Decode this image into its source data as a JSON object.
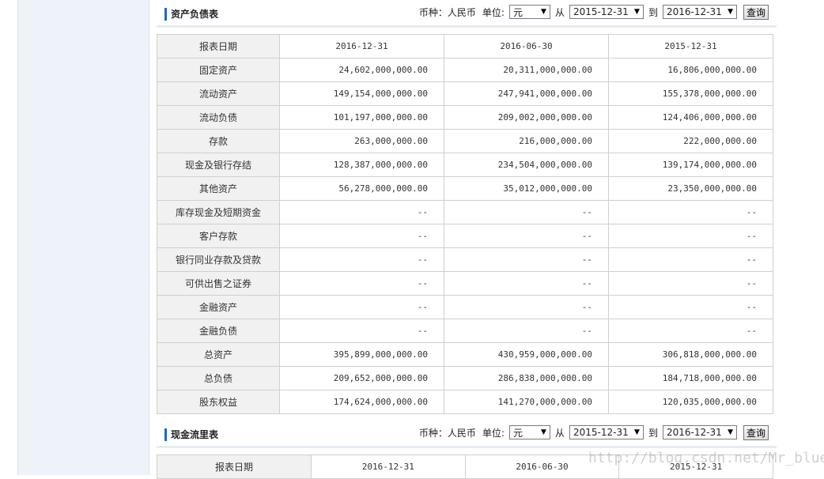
{
  "balance_sheet": {
    "title": "资产负债表",
    "currency_label": "币种：人民币",
    "unit_label": "单位:",
    "unit_value": "元",
    "from_label": "从",
    "from_date": "2015-12-31",
    "to_label": "到",
    "to_date": "2016-12-31",
    "query_label": "查询",
    "header_label": "报表日期",
    "header_dates": [
      "2016-12-31",
      "2016-06-30",
      "2015-12-31"
    ],
    "rows": [
      {
        "label": "固定资产",
        "values": [
          "24,602,000,000.00",
          "20,311,000,000.00",
          "16,806,000,000.00"
        ]
      },
      {
        "label": "流动资产",
        "values": [
          "149,154,000,000.00",
          "247,941,000,000.00",
          "155,378,000,000.00"
        ]
      },
      {
        "label": "流动负债",
        "values": [
          "101,197,000,000.00",
          "209,002,000,000.00",
          "124,406,000,000.00"
        ]
      },
      {
        "label": "存款",
        "values": [
          "263,000,000.00",
          "216,000,000.00",
          "222,000,000.00"
        ]
      },
      {
        "label": "现金及银行存结",
        "values": [
          "128,387,000,000.00",
          "234,504,000,000.00",
          "139,174,000,000.00"
        ]
      },
      {
        "label": "其他资产",
        "values": [
          "56,278,000,000.00",
          "35,012,000,000.00",
          "23,350,000,000.00"
        ]
      },
      {
        "label": "库存现金及短期资金",
        "values": [
          "--",
          "--",
          "--"
        ]
      },
      {
        "label": "客户存款",
        "values": [
          "--",
          "--",
          "--"
        ]
      },
      {
        "label": "银行同业存款及贷款",
        "values": [
          "--",
          "--",
          "--"
        ]
      },
      {
        "label": "可供出售之证券",
        "values": [
          "--",
          "--",
          "--"
        ]
      },
      {
        "label": "金融资产",
        "values": [
          "--",
          "--",
          "--"
        ]
      },
      {
        "label": "金融负债",
        "values": [
          "--",
          "--",
          "--"
        ]
      },
      {
        "label": "总资产",
        "values": [
          "395,899,000,000.00",
          "430,959,000,000.00",
          "306,818,000,000.00"
        ]
      },
      {
        "label": "总负债",
        "values": [
          "209,652,000,000.00",
          "286,838,000,000.00",
          "184,718,000,000.00"
        ]
      },
      {
        "label": "股东权益",
        "values": [
          "174,624,000,000.00",
          "141,270,000,000.00",
          "120,035,000,000.00"
        ]
      }
    ]
  },
  "cash_flow": {
    "title": "现金流里表",
    "currency_label": "币种：人民币",
    "unit_label": "单位:",
    "unit_value": "元",
    "from_label": "从",
    "from_date": "2015-12-31",
    "to_label": "到",
    "to_date": "2016-12-31",
    "query_label": "查询",
    "header_label": "报表日期",
    "header_dates": [
      "2016-12-31",
      "2016-06-30",
      "2015-12-31"
    ]
  },
  "watermark": "http://blog.csdn.net/Mr_blueD"
}
